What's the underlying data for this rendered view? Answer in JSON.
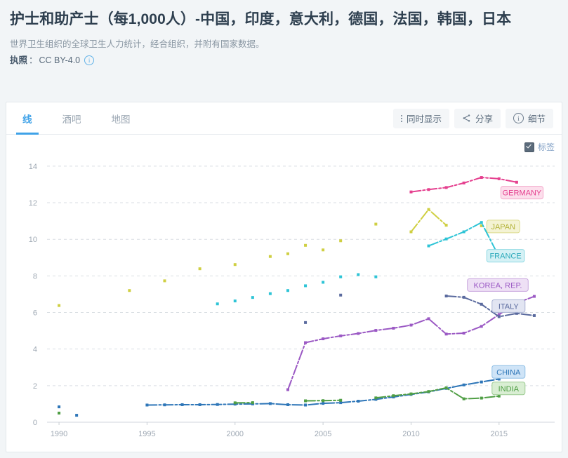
{
  "header": {
    "title": "护士和助产士（每1,000人）-中国，印度，意大利，德国，法国，韩国，日本",
    "subtitle": "世界卫生组织的全球卫生人力统计，经合组织，并附有国家数据。",
    "license_label": "执照",
    "license_sep": "：",
    "license_value": "CC BY-4.0",
    "info_glyph": "i"
  },
  "tabs": [
    {
      "label": "线",
      "active": true
    },
    {
      "label": "酒吧",
      "active": false
    },
    {
      "label": "地图",
      "active": false
    }
  ],
  "toolbar": {
    "simultaneous_label": "同时显示",
    "share_label": "分享",
    "details_label": "细节"
  },
  "chart_toggle": {
    "labels_label": "标签",
    "checked": true
  },
  "chart_data": {
    "type": "line",
    "title": "护士和助产士（每1,000人）",
    "xlabel": "",
    "ylabel": "",
    "xlim": [
      1989,
      2017.6
    ],
    "ylim": [
      0,
      14.8
    ],
    "xticks": [
      1990,
      1995,
      2000,
      2005,
      2010,
      2015
    ],
    "yticks": [
      0,
      2,
      4,
      6,
      8,
      10,
      12,
      14
    ],
    "grid": true,
    "legend": "inline-end-labels",
    "series": [
      {
        "name": "GERMANY",
        "color": "#e5408f",
        "label_fill": "#fcdfec",
        "label_stroke": "#f4a7ca",
        "label_text": "#e5408f",
        "label_x": 2015.1,
        "label_y": 12.55,
        "points": [
          {
            "x": 2010,
            "y": 12.59
          },
          {
            "x": 2011,
            "y": 12.72
          },
          {
            "x": 2012,
            "y": 12.83
          },
          {
            "x": 2013,
            "y": 13.08
          },
          {
            "x": 2014,
            "y": 13.38
          },
          {
            "x": 2015,
            "y": 13.31
          },
          {
            "x": 2016,
            "y": 13.12
          }
        ]
      },
      {
        "name": "JAPAN",
        "color": "#cfcf42",
        "label_fill": "#f4f3d4",
        "label_stroke": "#dcdb8e",
        "label_text": "#b4b43c",
        "label_x": 2014.3,
        "label_y": 10.7,
        "points": [
          {
            "x": 1990,
            "y": 6.38
          },
          {
            "x": 1994,
            "y": 7.2
          },
          {
            "x": 1996,
            "y": 7.73
          },
          {
            "x": 1998,
            "y": 8.39
          },
          {
            "x": 2000,
            "y": 8.62
          },
          {
            "x": 2002,
            "y": 9.06
          },
          {
            "x": 2003,
            "y": 9.21
          },
          {
            "x": 2004,
            "y": 9.67
          },
          {
            "x": 2005,
            "y": 9.42
          },
          {
            "x": 2006,
            "y": 9.92
          },
          {
            "x": 2008,
            "y": 10.83
          },
          {
            "x": 2010,
            "y": 10.41
          },
          {
            "x": 2011,
            "y": 11.63
          },
          {
            "x": 2012,
            "y": 10.77
          },
          {
            "x": 2014,
            "y": 10.74
          }
        ],
        "segments": [
          [
            2010,
            2011,
            2012
          ]
        ]
      },
      {
        "name": "FRANCE",
        "color": "#2ec4d6",
        "label_fill": "#d5f1f5",
        "label_stroke": "#8ed9e3",
        "label_text": "#2ba9ba",
        "label_x": 2014.3,
        "label_y": 9.1,
        "points": [
          {
            "x": 1999,
            "y": 6.47
          },
          {
            "x": 2000,
            "y": 6.63
          },
          {
            "x": 2001,
            "y": 6.82
          },
          {
            "x": 2002,
            "y": 7.03
          },
          {
            "x": 2003,
            "y": 7.2
          },
          {
            "x": 2004,
            "y": 7.46
          },
          {
            "x": 2005,
            "y": 7.65
          },
          {
            "x": 2006,
            "y": 7.95
          },
          {
            "x": 2007,
            "y": 8.07
          },
          {
            "x": 2008,
            "y": 7.95
          },
          {
            "x": 2011,
            "y": 9.64
          },
          {
            "x": 2012,
            "y": 10.02
          },
          {
            "x": 2013,
            "y": 10.41
          },
          {
            "x": 2014,
            "y": 10.92
          },
          {
            "x": 2015,
            "y": 9.04
          }
        ],
        "segments": [
          [
            2011,
            2012,
            2013,
            2014,
            2015
          ]
        ]
      },
      {
        "name": "KOREA, REP.",
        "color": "#9b59c4",
        "label_fill": "#eee0f5",
        "label_stroke": "#c9a8de",
        "label_text": "#9b59c4",
        "label_x": 2013.2,
        "label_y": 7.5,
        "points": [
          {
            "x": 2003,
            "y": 1.78
          },
          {
            "x": 2004,
            "y": 4.35
          },
          {
            "x": 2005,
            "y": 4.56
          },
          {
            "x": 2006,
            "y": 4.72
          },
          {
            "x": 2007,
            "y": 4.85
          },
          {
            "x": 2008,
            "y": 5.02
          },
          {
            "x": 2009,
            "y": 5.14
          },
          {
            "x": 2010,
            "y": 5.31
          },
          {
            "x": 2011,
            "y": 5.66
          },
          {
            "x": 2012,
            "y": 4.82
          },
          {
            "x": 2013,
            "y": 4.87
          },
          {
            "x": 2014,
            "y": 5.24
          },
          {
            "x": 2015,
            "y": 5.89
          },
          {
            "x": 2016,
            "y": 6.52
          },
          {
            "x": 2017,
            "y": 6.88
          }
        ]
      },
      {
        "name": "ITALY",
        "color": "#5a6a9e",
        "label_fill": "#e2e5f2",
        "label_stroke": "#a9b2d3",
        "label_text": "#5a6a9e",
        "label_x": 2014.6,
        "label_y": 6.35,
        "points": [
          {
            "x": 2004,
            "y": 5.45
          },
          {
            "x": 2006,
            "y": 6.95
          },
          {
            "x": 2012,
            "y": 6.9
          },
          {
            "x": 2013,
            "y": 6.83
          },
          {
            "x": 2014,
            "y": 6.45
          },
          {
            "x": 2015,
            "y": 5.77
          },
          {
            "x": 2016,
            "y": 5.95
          },
          {
            "x": 2017,
            "y": 5.83
          }
        ],
        "segments": [
          [
            2012,
            2013,
            2014,
            2015,
            2016,
            2017
          ]
        ]
      },
      {
        "name": "CHINA",
        "color": "#2e76b8",
        "label_fill": "#cfe4f7",
        "label_stroke": "#8fbfe6",
        "label_text": "#2e76b8",
        "label_x": 2014.6,
        "label_y": 2.75,
        "points": [
          {
            "x": 1990,
            "y": 0.84
          },
          {
            "x": 1991,
            "y": 0.38
          },
          {
            "x": 1995,
            "y": 0.94
          },
          {
            "x": 1996,
            "y": 0.95
          },
          {
            "x": 1997,
            "y": 0.96
          },
          {
            "x": 1998,
            "y": 0.96
          },
          {
            "x": 1999,
            "y": 0.97
          },
          {
            "x": 2000,
            "y": 0.99
          },
          {
            "x": 2001,
            "y": 1.0
          },
          {
            "x": 2002,
            "y": 1.02
          },
          {
            "x": 2003,
            "y": 0.96
          },
          {
            "x": 2004,
            "y": 0.94
          },
          {
            "x": 2005,
            "y": 1.03
          },
          {
            "x": 2006,
            "y": 1.07
          },
          {
            "x": 2007,
            "y": 1.15
          },
          {
            "x": 2008,
            "y": 1.25
          },
          {
            "x": 2009,
            "y": 1.38
          },
          {
            "x": 2010,
            "y": 1.52
          },
          {
            "x": 2011,
            "y": 1.66
          },
          {
            "x": 2012,
            "y": 1.85
          },
          {
            "x": 2013,
            "y": 2.04
          },
          {
            "x": 2014,
            "y": 2.2
          },
          {
            "x": 2015,
            "y": 2.36
          }
        ],
        "segments": [
          [
            1995,
            1996,
            1997,
            1998,
            1999,
            2000,
            2001,
            2002,
            2003,
            2004,
            2005,
            2006,
            2007,
            2008,
            2009,
            2010,
            2011,
            2012,
            2013,
            2014,
            2015
          ]
        ]
      },
      {
        "name": "INDIA",
        "color": "#4f9e44",
        "label_fill": "#d9eed3",
        "label_stroke": "#9ccb92",
        "label_text": "#4f9e44",
        "label_x": 2014.6,
        "label_y": 1.85,
        "points": [
          {
            "x": 1990,
            "y": 0.5
          },
          {
            "x": 2000,
            "y": 1.06
          },
          {
            "x": 2001,
            "y": 1.07
          },
          {
            "x": 2004,
            "y": 1.17
          },
          {
            "x": 2005,
            "y": 1.18
          },
          {
            "x": 2006,
            "y": 1.2
          },
          {
            "x": 2008,
            "y": 1.33
          },
          {
            "x": 2009,
            "y": 1.45
          },
          {
            "x": 2010,
            "y": 1.55
          },
          {
            "x": 2011,
            "y": 1.68
          },
          {
            "x": 2012,
            "y": 1.88
          },
          {
            "x": 2013,
            "y": 1.28
          },
          {
            "x": 2014,
            "y": 1.32
          },
          {
            "x": 2015,
            "y": 1.43
          }
        ],
        "segments": [
          [
            2000,
            2001
          ],
          [
            2004,
            2005,
            2006
          ],
          [
            2008,
            2009,
            2010,
            2011,
            2012,
            2013,
            2014,
            2015
          ]
        ]
      }
    ]
  }
}
